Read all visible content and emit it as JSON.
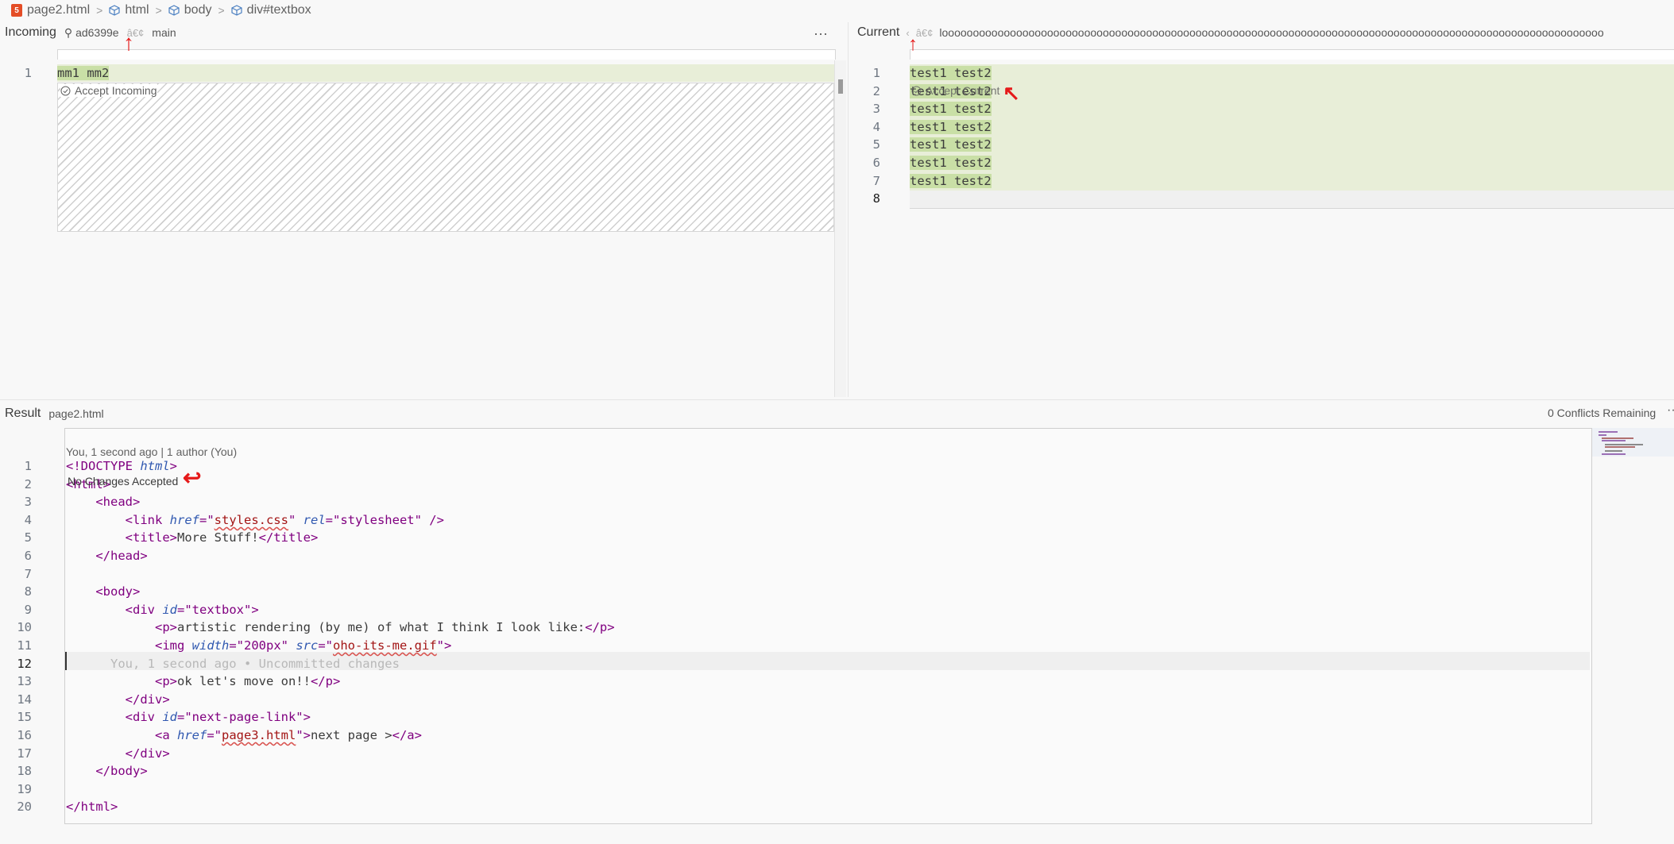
{
  "breadcrumb": {
    "file": "page2.html",
    "items": [
      "html",
      "body",
      "div#textbox"
    ]
  },
  "incoming": {
    "title": "Incoming",
    "commit": "ad6399e",
    "glyph": "â€¢",
    "branch": "main",
    "more": "···",
    "lines": [
      {
        "num": "1",
        "text": "mm1 mm2"
      }
    ],
    "accept_label": "Accept Incoming"
  },
  "current": {
    "title": "Current",
    "glyph": "â€¢",
    "branch_prefix": "‹",
    "branch": "looooooooooooooooooooooooooooooooooooooooooooooooooooooooooooooooooooooooooooooooooooooooooooooooooooooooooo",
    "lines": [
      {
        "num": "1",
        "text": "test1 test2"
      },
      {
        "num": "2",
        "text": "test1 test2"
      },
      {
        "num": "3",
        "text": "test1 test2"
      },
      {
        "num": "4",
        "text": "test1 test2"
      },
      {
        "num": "5",
        "text": "test1 test2"
      },
      {
        "num": "6",
        "text": "test1 test2"
      },
      {
        "num": "7",
        "text": "test1 test2"
      },
      {
        "num": "8",
        "text": ""
      }
    ],
    "accept_label": "Accept Current"
  },
  "result": {
    "title": "Result",
    "file": "page2.html",
    "conflicts": "0 Conflicts Remaining",
    "blame": "You, 1 second ago | 1 author (You)",
    "no_changes": "No Changes Accepted",
    "inline_blame": "You, 1 second ago • Uncommitted changes",
    "line_numbers": [
      "1",
      "2",
      "3",
      "4",
      "5",
      "6",
      "7",
      "8",
      "9",
      "10",
      "11",
      "12",
      "13",
      "14",
      "15",
      "16",
      "17",
      "18",
      "19",
      "20"
    ],
    "code": {
      "l1a": "<!DOCTYPE ",
      "l1b": "html",
      "l1c": ">",
      "l2": "<html>",
      "l3": "<head>",
      "l4a": "<link ",
      "l4b": "href",
      "l4c": "=\"",
      "l4d": "styles.css",
      "l4e": "\" ",
      "l4f": "rel",
      "l4g": "=\"stylesheet\" />",
      "l5a": "<title>",
      "l5b": "More Stuff!",
      "l5c": "</title>",
      "l6": "</head>",
      "l8": "<body>",
      "l9a": "<div ",
      "l9b": "id",
      "l9c": "=\"textbox\">",
      "l10a": "<p>",
      "l10b": "artistic rendering (by me) of what I think I look like:",
      "l10c": "</p>",
      "l11a": "<img ",
      "l11b": "width",
      "l11c": "=\"200px\" ",
      "l11d": "src",
      "l11e": "=\"",
      "l11f": "oho-its-me.gif",
      "l11g": "\">",
      "l13a": "<p>",
      "l13b": "ok let's move on!!",
      "l13c": "</p>",
      "l14": "</div>",
      "l15a": "<div ",
      "l15b": "id",
      "l15c": "=\"next-page-link\">",
      "l16a": "<a ",
      "l16b": "href",
      "l16c": "=\"",
      "l16d": "page3.html",
      "l16e": "\">",
      "l16f": "next page >",
      "l16g": "</a>",
      "l17": "</div>",
      "l18": "</body>",
      "l20": "</html>"
    }
  },
  "annotations": {
    "arrow_up": "↑",
    "arrow_mark": "↖",
    "arrow_left": "↩"
  },
  "colors": {
    "accept_bg": "#e8eed8",
    "highlight": "#c9dfa6",
    "annotation": "#e51a1a"
  }
}
